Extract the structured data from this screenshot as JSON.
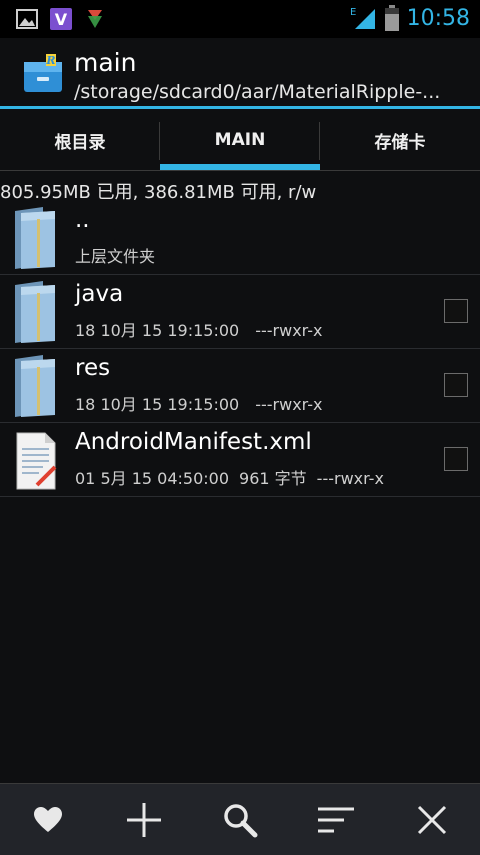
{
  "status_bar": {
    "time": "10:58",
    "network_type": "E",
    "left_icons": [
      "image-icon",
      "viber-icon",
      "download-icon"
    ]
  },
  "header": {
    "title": "main",
    "path": "/storage/sdcard0/aar/MaterialRipple-..."
  },
  "tabs": [
    {
      "label": "根目录",
      "active": false
    },
    {
      "label": "MAIN",
      "active": true
    },
    {
      "label": "存储卡",
      "active": false
    }
  ],
  "storage_info": "805.95MB 已用, 386.81MB 可用, r/w",
  "files": [
    {
      "name": "..",
      "subtitle": "上层文件夹",
      "icon": "folder-icon"
    },
    {
      "name": "java",
      "date": "18 10月 15 19:15:00",
      "size": "",
      "perms": "---rwxr-x",
      "icon": "folder-icon"
    },
    {
      "name": "res",
      "date": "18 10月 15 19:15:00",
      "size": "",
      "perms": "---rwxr-x",
      "icon": "folder-icon"
    },
    {
      "name": "AndroidManifest.xml",
      "date": "01 5月 15 04:50:00",
      "size": "961 字节",
      "perms": "---rwxr-x",
      "icon": "file-icon"
    }
  ],
  "bottom_bar": [
    "favorite-icon",
    "add-icon",
    "search-icon",
    "sort-icon",
    "close-icon"
  ],
  "colors": {
    "accent": "#33b5e5",
    "background": "#0e0f11",
    "bottom_bar": "#222429"
  }
}
